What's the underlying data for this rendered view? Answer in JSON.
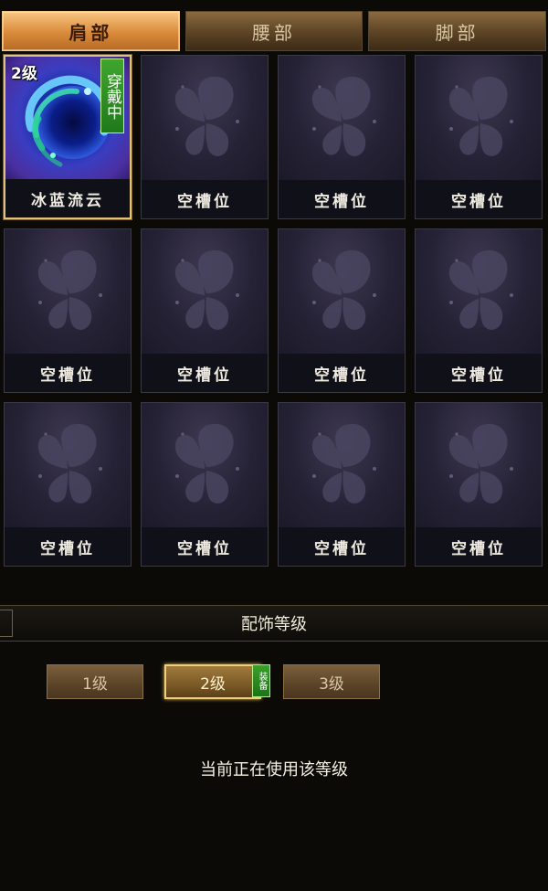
{
  "tabs": [
    {
      "label": "肩部",
      "active": true
    },
    {
      "label": "腰部",
      "active": false
    },
    {
      "label": "脚部",
      "active": false
    }
  ],
  "slots": [
    {
      "label": "冰蓝流云",
      "level_badge": "2级",
      "wear_tag": "穿戴中",
      "equipped": true,
      "icon": "blue-swirl-icon"
    },
    {
      "label": "空槽位",
      "icon": "butterfly-icon"
    },
    {
      "label": "空槽位",
      "icon": "butterfly-icon"
    },
    {
      "label": "空槽位",
      "icon": "butterfly-icon"
    },
    {
      "label": "空槽位",
      "icon": "butterfly-icon"
    },
    {
      "label": "空槽位",
      "icon": "butterfly-icon"
    },
    {
      "label": "空槽位",
      "icon": "butterfly-icon"
    },
    {
      "label": "空槽位",
      "icon": "butterfly-icon"
    },
    {
      "label": "空槽位",
      "icon": "butterfly-icon"
    },
    {
      "label": "空槽位",
      "icon": "butterfly-icon"
    },
    {
      "label": "空槽位",
      "icon": "butterfly-icon"
    },
    {
      "label": "空槽位",
      "icon": "butterfly-icon"
    }
  ],
  "section": {
    "title": "配饰等级"
  },
  "levels": [
    {
      "label": "1级",
      "selected": false
    },
    {
      "label": "2级",
      "selected": true,
      "equip_tag": "装备"
    },
    {
      "label": "3级",
      "selected": false
    }
  ],
  "status_text": "当前正在使用该等级",
  "colors": {
    "tab_active": "#d98a3a",
    "tab_inactive": "#5f4626",
    "equipped_border": "#e1c27c",
    "wear_tag_green": "#3fa52e",
    "background": "#0c0a07"
  }
}
